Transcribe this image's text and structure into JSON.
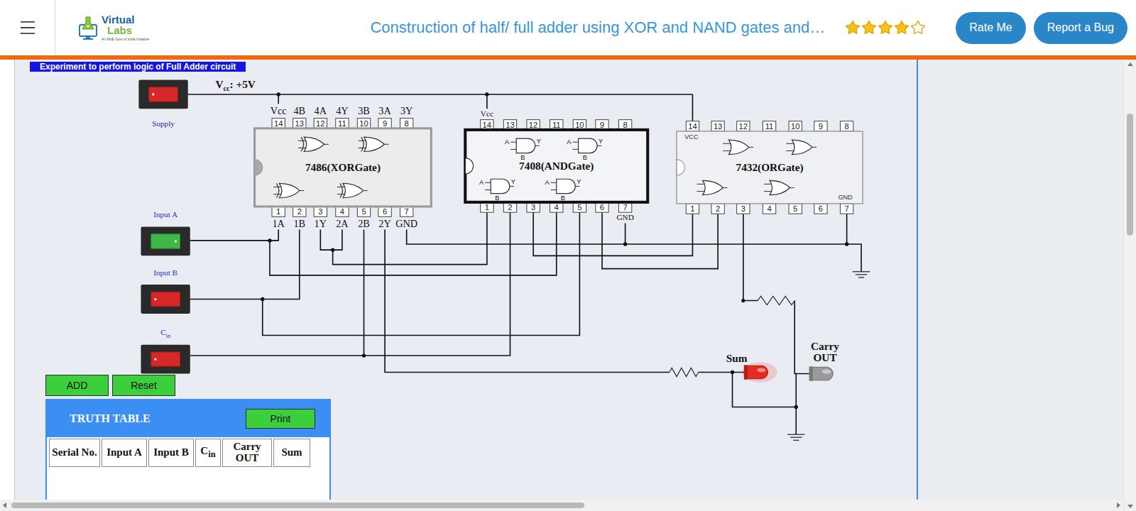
{
  "header": {
    "logo": {
      "name_1": "Virtual",
      "name_2": "Labs",
      "tagline": "An MoE Govt of India Initiative"
    },
    "title": "Construction of half/ full adder using XOR and NAND gates and…",
    "rating": {
      "stars": 4,
      "max": 5
    },
    "buttons": [
      "Rate Me",
      "Report a Bug"
    ]
  },
  "experiment": {
    "banner": "Experiment to perform logic of Full Adder circuit",
    "supply_label": {
      "base": "V",
      "sub": "cc",
      "suffix": ": +5V"
    },
    "switches": [
      {
        "label": "Supply",
        "sub": "",
        "on": false
      },
      {
        "label": "Input A",
        "sub": "",
        "on": true
      },
      {
        "label": "Input B",
        "sub": "",
        "on": false
      },
      {
        "label": "C",
        "sub": "in",
        "on": false
      }
    ],
    "chips": [
      {
        "kind": "xor",
        "name": "7486(XORGate)",
        "top_labels": [
          "Vcc",
          "4B",
          "4A",
          "4Y",
          "3B",
          "3A",
          "3Y"
        ],
        "bottom_labels": [
          "1A",
          "1B",
          "1Y",
          "2A",
          "2B",
          "2Y",
          "GND"
        ],
        "top_pins": [
          "14",
          "13",
          "12",
          "11",
          "10",
          "9",
          "8"
        ],
        "bottom_pins": [
          "1",
          "2",
          "3",
          "4",
          "5",
          "6",
          "7"
        ],
        "gate_labels": [],
        "inner_top": "",
        "inner_bottom": ""
      },
      {
        "kind": "and",
        "name": "7408(ANDGate)",
        "top_labels": [
          "Vcc",
          "",
          "",
          "",
          "",
          "",
          ""
        ],
        "bottom_labels": [
          "",
          "",
          "",
          "",
          "",
          "",
          "GND"
        ],
        "top_pins": [
          "14",
          "13",
          "12",
          "11",
          "10",
          "9",
          "8"
        ],
        "bottom_pins": [
          "1",
          "2",
          "3",
          "4",
          "5",
          "6",
          "7"
        ],
        "gate_labels": [
          "A",
          "B",
          "Y"
        ],
        "inner_top": "",
        "inner_bottom": ""
      },
      {
        "kind": "or",
        "name": "7432(ORGate)",
        "top_labels": [
          "",
          "",
          "",
          "",
          "",
          "",
          ""
        ],
        "bottom_labels": [
          "",
          "",
          "",
          "",
          "",
          "",
          ""
        ],
        "top_pins": [
          "14",
          "13",
          "12",
          "11",
          "10",
          "9",
          "8"
        ],
        "bottom_pins": [
          "1",
          "2",
          "3",
          "4",
          "5",
          "6",
          "7"
        ],
        "gate_labels": [],
        "inner_top": "VCC",
        "inner_bottom": "GND"
      }
    ],
    "outputs": [
      {
        "label": [
          "Sum"
        ],
        "lit": true,
        "color": "#e52a1f"
      },
      {
        "label": [
          "Carry",
          "OUT"
        ],
        "lit": false,
        "color": "#9a9a9a"
      }
    ]
  },
  "controls": {
    "buttons": [
      "ADD",
      "Reset"
    ]
  },
  "truth_table": {
    "title": "TRUTH TABLE",
    "print": "Print",
    "columns": [
      {
        "text": "Serial No.",
        "sub": ""
      },
      {
        "text": "Input A",
        "sub": ""
      },
      {
        "text": "Input B",
        "sub": ""
      },
      {
        "text": "C",
        "sub": "in"
      },
      {
        "text": "Carry OUT",
        "sub": ""
      },
      {
        "text": "Sum",
        "sub": ""
      }
    ],
    "rows": []
  },
  "scrollbars": {
    "vertical": {
      "start": 0.12,
      "level": 0.27
    },
    "horizontal": {
      "start": 0.01,
      "level": 0.51
    }
  }
}
